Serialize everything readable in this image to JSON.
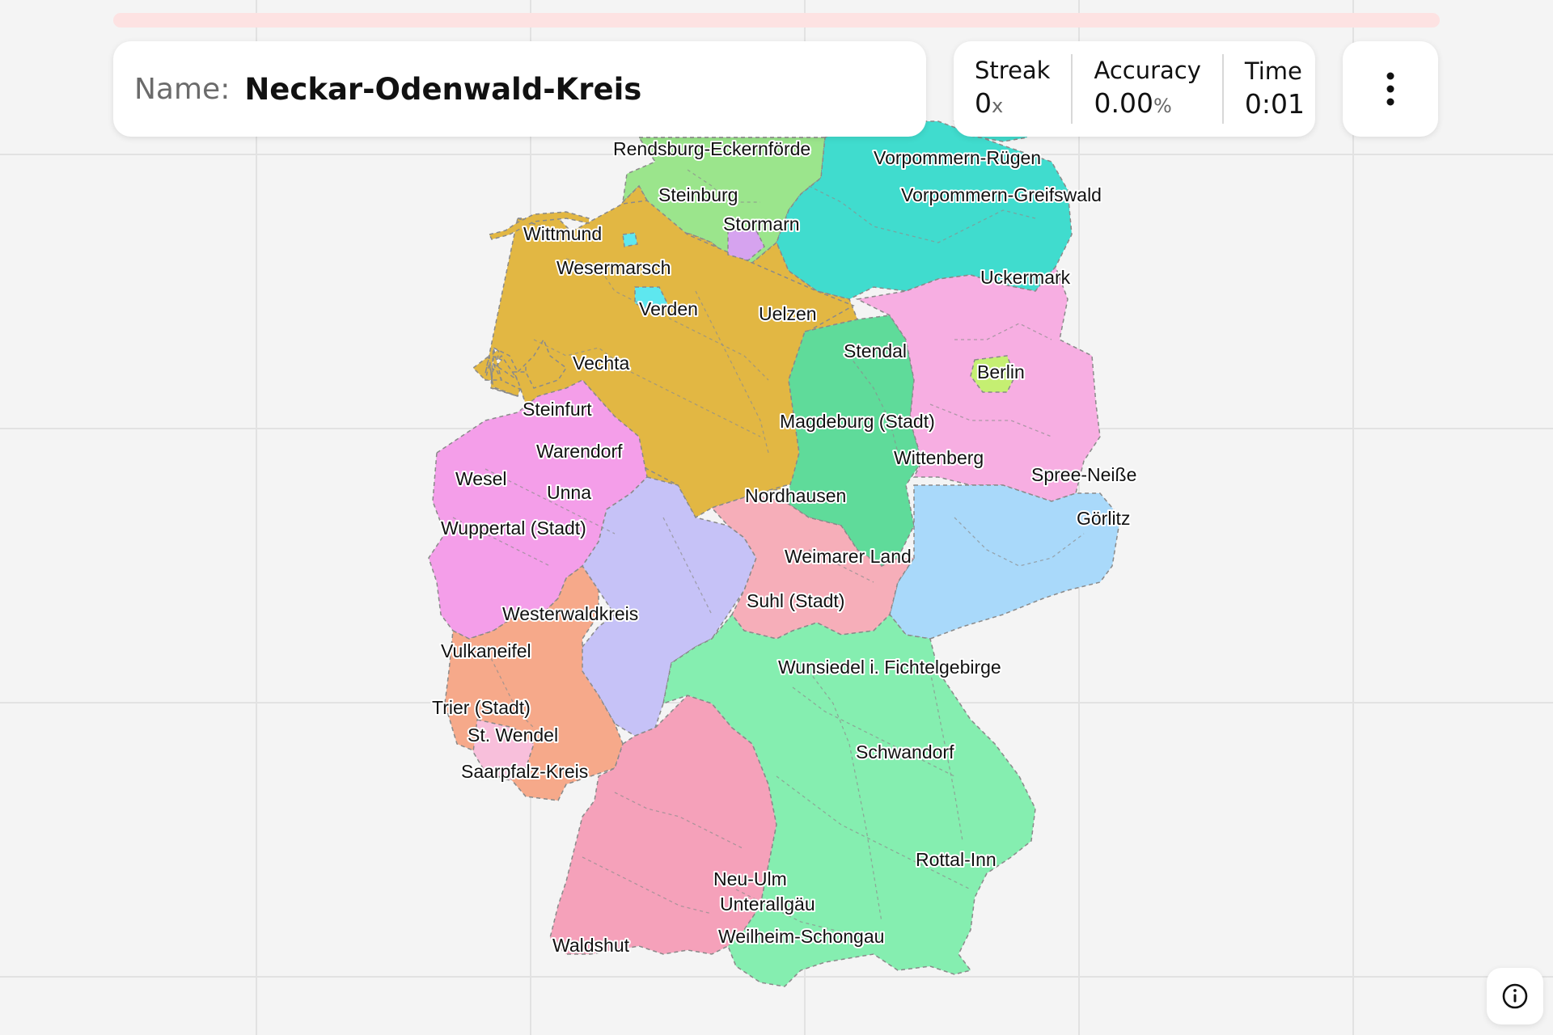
{
  "progress": {
    "fraction": 0.0,
    "track_color": "#fde2e2",
    "fill_color": "#f07f7f"
  },
  "prompt": {
    "label": "Name:",
    "value": "Neckar-Odenwald-Kreis"
  },
  "stats": {
    "streak": {
      "label": "Streak",
      "value": "0",
      "unit": "x"
    },
    "accuracy": {
      "label": "Accuracy",
      "value": "0.00",
      "unit": "%"
    },
    "time": {
      "label": "Time",
      "value": "0:01"
    }
  },
  "menu": {
    "icon": "more-vertical-icon"
  },
  "info": {
    "icon": "info-icon"
  },
  "map": {
    "country": "Germany",
    "state_colors": {
      "schleswig_holstein": "#9be58c",
      "mecklenburg_vorpommern": "#40dcce",
      "niedersachsen": "#e2b743",
      "bremen": "#5ee7ef",
      "hamburg": "#d6a3ef",
      "brandenburg": "#f7aee2",
      "berlin": "#c5ef72",
      "sachsen_anhalt": "#5fdb9a",
      "nordrhein_westfalen": "#f49ee9",
      "hessen": "#c6c2f7",
      "thueringen": "#f6aeb9",
      "sachsen": "#a9d9fa",
      "rheinland_pfalz": "#f6a98a",
      "saarland": "#f8bfdb",
      "baden_wuerttemberg": "#f5a1ba",
      "bayern": "#85eeb0"
    },
    "labels": [
      "Rendsburg-Eckernförde",
      "Vorpommern-Rügen",
      "Steinburg",
      "Vorpommern-Greifswald",
      "Wittmund",
      "Stormarn",
      "Wesermarsch",
      "Uckermark",
      "Verden",
      "Uelzen",
      "Stendal",
      "Vechta",
      "Berlin",
      "Steinfurt",
      "Magdeburg (Stadt)",
      "Warendorf",
      "Wittenberg",
      "Wesel",
      "Spree-Neiße",
      "Unna",
      "Nordhausen",
      "Görlitz",
      "Wuppertal (Stadt)",
      "Weimarer Land",
      "Suhl (Stadt)",
      "Westerwaldkreis",
      "Vulkaneifel",
      "Wunsiedel i. Fichtelgebirge",
      "Trier (Stadt)",
      "St. Wendel",
      "Schwandorf",
      "Saarpfalz-Kreis",
      "Rottal-Inn",
      "Neu-Ulm",
      "Unterallgäu",
      "Weilheim-Schongau",
      "Waldshut"
    ]
  }
}
